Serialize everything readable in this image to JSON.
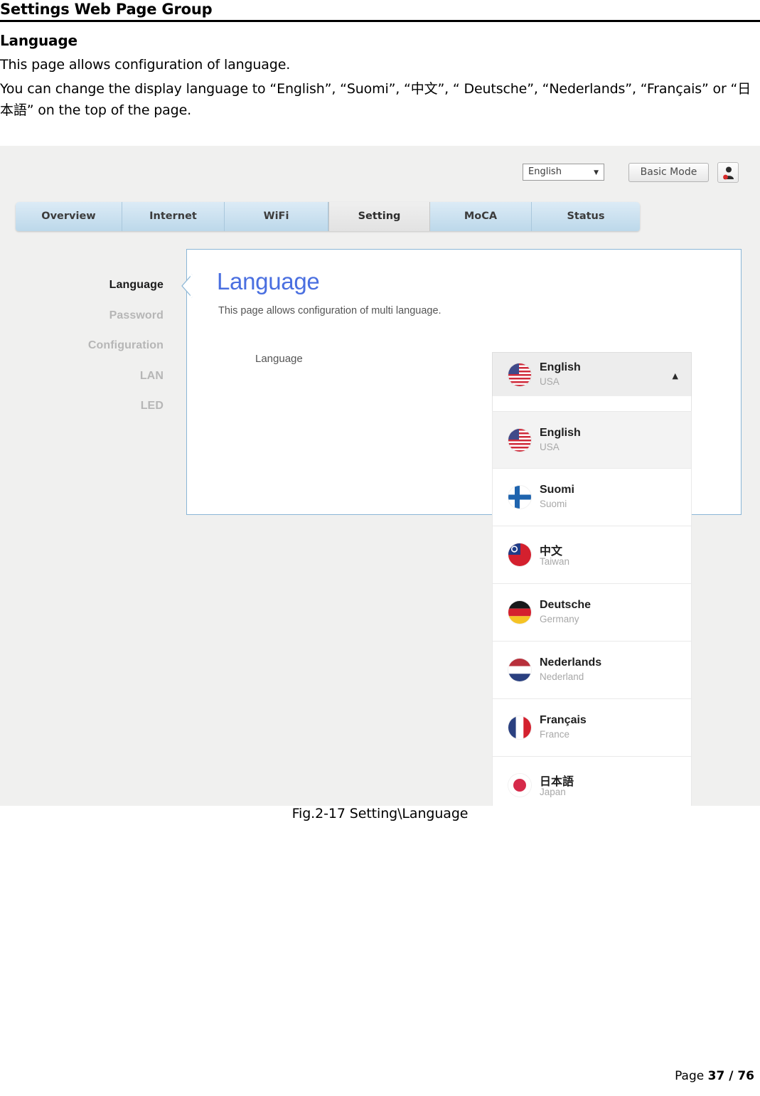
{
  "document": {
    "header_title": "Settings Web Page Group",
    "section_title": "Language",
    "para1": "This page allows configuration of language.",
    "para2": "You can change the display language to “English”, “Suomi”, “中文”, “ Deutsche”, “Nederlands”, “Français” or “日本語” on the top of the page.",
    "figure_caption": "Fig.2-17 Setting\\Language",
    "footer_prefix": "Page ",
    "footer_page": "37 / 76"
  },
  "screenshot": {
    "topbar": {
      "language_select_value": "English",
      "caret_icon": "▼",
      "basic_mode_label": "Basic Mode",
      "user_icon": "user-account-icon"
    },
    "tabs": [
      {
        "label": "Overview",
        "active": false
      },
      {
        "label": "Internet",
        "active": false
      },
      {
        "label": "WiFi",
        "active": false
      },
      {
        "label": "Setting",
        "active": true
      },
      {
        "label": "MoCA",
        "active": false
      },
      {
        "label": "Status",
        "active": false
      }
    ],
    "sidebar": [
      {
        "label": "Language",
        "active": true
      },
      {
        "label": "Password",
        "active": false
      },
      {
        "label": "Configuration",
        "active": false
      },
      {
        "label": "LAN",
        "active": false
      },
      {
        "label": "LED",
        "active": false
      }
    ],
    "panel": {
      "title": "Language",
      "subtitle": "This page allows configuration of multi language.",
      "field_label": "Language"
    },
    "dropdown": {
      "expanded": true,
      "arrow_icon": "▲",
      "selected": {
        "name": "English",
        "region": "USA",
        "flag": "flag-usa"
      },
      "options": [
        {
          "name": "English",
          "region": "USA",
          "flag": "flag-usa",
          "highlighted": true
        },
        {
          "name": "Suomi",
          "region": "Suomi",
          "flag": "flag-finland",
          "highlighted": false
        },
        {
          "name": "中文",
          "region": "Taiwan",
          "flag": "flag-taiwan",
          "highlighted": false
        },
        {
          "name": "Deutsche",
          "region": "Germany",
          "flag": "flag-germany",
          "highlighted": false
        },
        {
          "name": "Nederlands",
          "region": "Nederland",
          "flag": "flag-netherlands",
          "highlighted": false
        },
        {
          "name": "Français",
          "region": "France",
          "flag": "flag-france",
          "highlighted": false
        },
        {
          "name": "日本語",
          "region": "Japan",
          "flag": "flag-japan",
          "highlighted": false
        }
      ]
    }
  },
  "colors": {
    "panel_border": "#8ab6d6",
    "panel_title": "#4a6fe0",
    "tab_active_bg": "#e2e2e2",
    "tab_bg": "#bcd8ea",
    "shot_bg": "#f0f0ef"
  }
}
